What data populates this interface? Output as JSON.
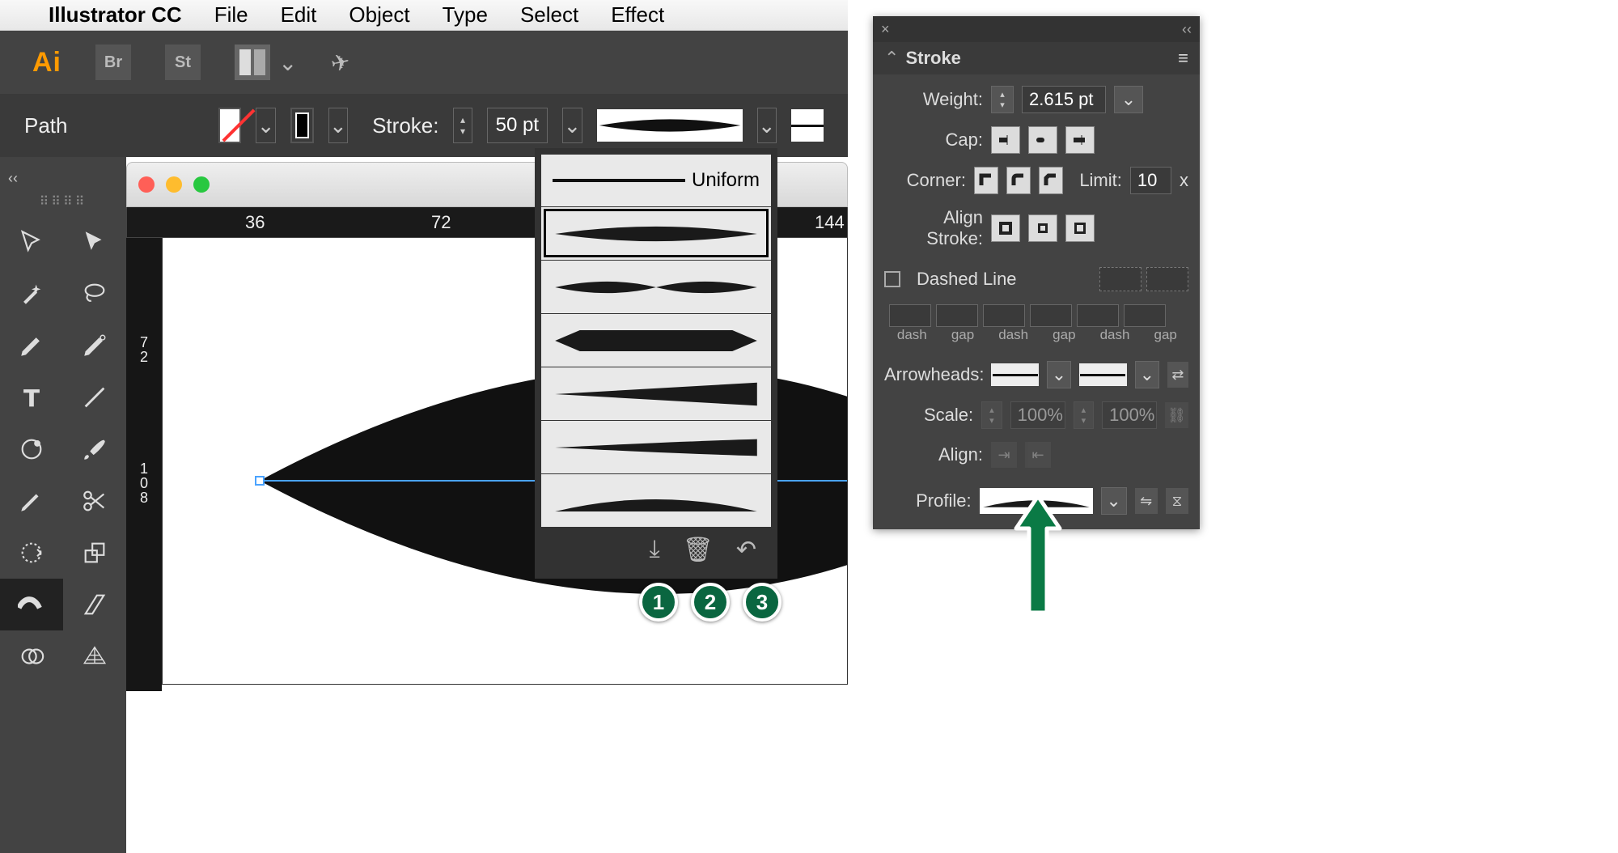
{
  "menubar": {
    "app_name": "Illustrator CC",
    "items": [
      "File",
      "Edit",
      "Object",
      "Type",
      "Select",
      "Effect"
    ]
  },
  "appbar": {
    "logo": "Ai",
    "br": "Br",
    "st": "St"
  },
  "control_bar": {
    "breadcrumb": "Path",
    "stroke_label": "Stroke:",
    "stroke_value": "50 pt"
  },
  "ruler": {
    "marks": [
      "36",
      "72",
      "144"
    ],
    "vert_marks": [
      "7\n2",
      "1\n0\n8"
    ]
  },
  "profile_dropdown": {
    "uniform_label": "Uniform",
    "badges": [
      "1",
      "2",
      "3"
    ]
  },
  "stroke_panel": {
    "title": "Stroke",
    "weight_label": "Weight:",
    "weight_value": "2.615 pt",
    "cap_label": "Cap:",
    "corner_label": "Corner:",
    "limit_label": "Limit:",
    "limit_value": "10",
    "limit_x": "x",
    "align_stroke_label": "Align Stroke:",
    "dashed_label": "Dashed Line",
    "dash_labels": [
      "dash",
      "gap",
      "dash",
      "gap",
      "dash",
      "gap"
    ],
    "arrowheads_label": "Arrowheads:",
    "scale_label": "Scale:",
    "scale_value": "100%",
    "align_label": "Align:",
    "profile_label": "Profile:"
  }
}
